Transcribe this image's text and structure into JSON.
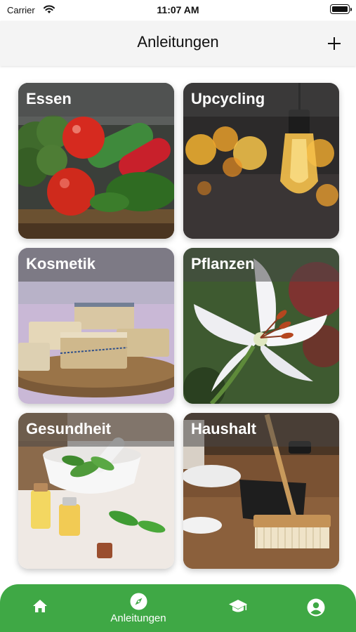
{
  "status": {
    "carrier": "Carrier",
    "time": "11:07 AM"
  },
  "header": {
    "title": "Anleitungen",
    "add_icon": "plus-icon"
  },
  "tiles": [
    {
      "label": "Essen"
    },
    {
      "label": "Upcycling"
    },
    {
      "label": "Kosmetik"
    },
    {
      "label": "Pflanzen"
    },
    {
      "label": "Gesundheit"
    },
    {
      "label": "Haushalt"
    }
  ],
  "tabbar": {
    "color": "#3fa845",
    "tabs": [
      {
        "icon": "home-icon",
        "label": ""
      },
      {
        "icon": "compass-icon",
        "label": "Anleitungen",
        "active": true
      },
      {
        "icon": "graduation-cap-icon",
        "label": ""
      },
      {
        "icon": "profile-icon",
        "label": ""
      }
    ]
  }
}
